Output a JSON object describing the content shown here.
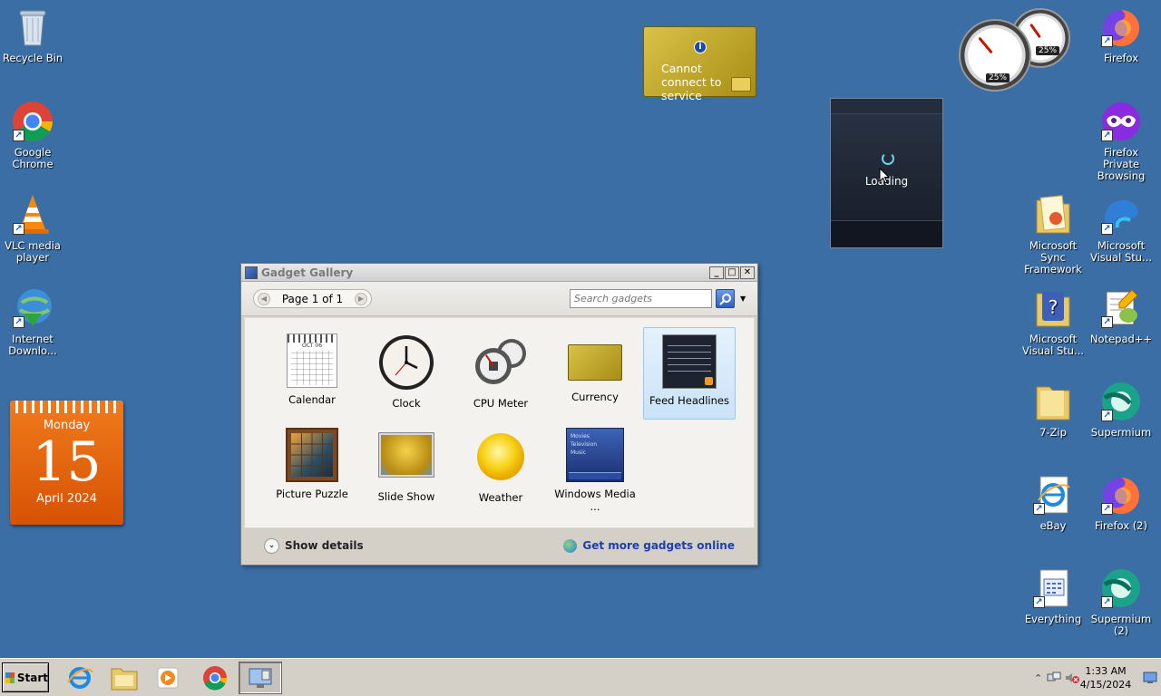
{
  "desktop": {
    "left_icons": [
      {
        "label": "Recycle Bin"
      },
      {
        "label": "Google Chrome"
      },
      {
        "label": "VLC media player"
      },
      {
        "label": "Internet Downlo..."
      }
    ],
    "right_icons": [
      {
        "label": "Firefox"
      },
      {
        "label": "Firefox Private Browsing"
      },
      {
        "label": "Microsoft Sync Framework"
      },
      {
        "label": "Microsoft Visual Stu..."
      },
      {
        "label": "Microsoft Visual Stu..."
      },
      {
        "label": "Notepad++"
      },
      {
        "label": "7-Zip"
      },
      {
        "label": "Supermium"
      },
      {
        "label": "eBay"
      },
      {
        "label": "Firefox (2)"
      },
      {
        "label": "Everything"
      },
      {
        "label": "Supermium (2)"
      }
    ]
  },
  "calendar_gadget": {
    "day_of_week": "Monday",
    "day": "15",
    "month_year": "April 2024"
  },
  "currency_gadget": {
    "message": "Cannot connect to service"
  },
  "cpu_gadget": {
    "cpu_value": "25%",
    "memory_value": "25%"
  },
  "feed_gadget": {
    "status": "Loading"
  },
  "gadget_gallery": {
    "title": "Gadget Gallery",
    "page_label": "Page 1 of 1",
    "search_placeholder": "Search gadgets",
    "items": [
      {
        "label": "Calendar"
      },
      {
        "label": "Clock"
      },
      {
        "label": "CPU Meter"
      },
      {
        "label": "Currency"
      },
      {
        "label": "Feed Headlines",
        "selected": true
      },
      {
        "label": "Picture Puzzle"
      },
      {
        "label": "Slide Show"
      },
      {
        "label": "Weather"
      },
      {
        "label": "Windows Media ..."
      }
    ],
    "calendar_thumb_month": "OCT 06",
    "show_details": "Show details",
    "get_more": "Get more gadgets online"
  },
  "taskbar": {
    "start_label": "Start",
    "time": "1:33 AM",
    "date": "4/15/2024"
  },
  "colors": {
    "desktop": "#3a6ea5",
    "calendar_orange": "#e66a10",
    "selection": "#c9e3f8"
  }
}
